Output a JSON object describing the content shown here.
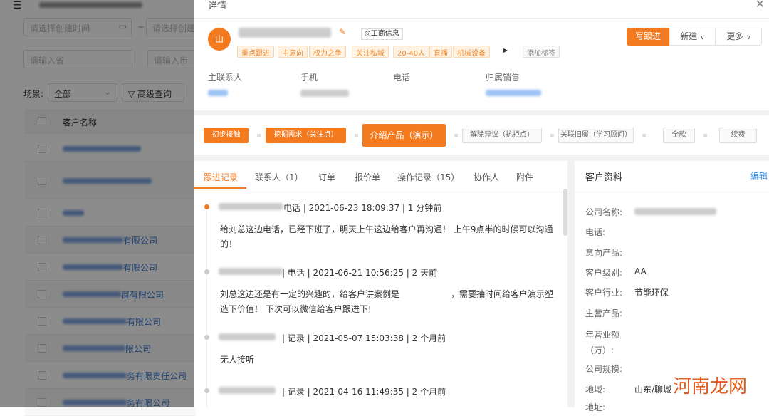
{
  "background": {
    "filters": {
      "date_placeholder": "请选择创建时间",
      "date_placeholder2": "请选择创建",
      "range_sep": "~",
      "province_placeholder": "请输入省",
      "city_placeholder": "请输入市"
    },
    "scene_label": "场景:",
    "scene_value": "全部",
    "advanced_query": "高级查询",
    "table_header": "客户名称",
    "rows": [
      "",
      "",
      "",
      "有限公司",
      "有限公司",
      "窗有限公司",
      "有限公司",
      "限公司",
      "务有限责任公司",
      "务有限公司"
    ]
  },
  "panel": {
    "title": "详情",
    "avatar_text": "山",
    "business_info": "工商信息",
    "tags": [
      "重点跟进",
      "中意向",
      "权力之争",
      "关注私域",
      "20-40人",
      "直播",
      "机械设备"
    ],
    "add_tag": "添加标签",
    "actions": {
      "write_followup": "写跟进",
      "new": "新建",
      "more": "更多"
    },
    "contact_labels": [
      "主联系人",
      "手机",
      "电话",
      "归属销售"
    ],
    "stages": [
      {
        "label": "初步接触",
        "active": true
      },
      {
        "label": "挖掘需求（关注点）",
        "active": true
      },
      {
        "label": "介绍产品（演示）",
        "active": true,
        "current": true
      },
      {
        "label": "解除异议（抗拒点）",
        "active": false
      },
      {
        "label": "关联旧履（学习顾问）",
        "active": false
      },
      {
        "label": "全款",
        "active": false
      },
      {
        "label": "续费",
        "active": false
      }
    ],
    "tabs": [
      "跟进记录",
      "联系人（1）",
      "订单",
      "报价单",
      "操作记录（15）",
      "协作人",
      "附件"
    ],
    "active_tab": "跟进记录",
    "records": [
      {
        "meta": "电话 | 2021-06-23 18:09:37 | 1 分钟前",
        "body": "给刘总这边电话，已经下班了，明天上午这边给客户再沟通！ 上午9点半的时候可以沟通的！"
      },
      {
        "meta": "| 电话 | 2021-06-21 10:56:25 | 2 天前",
        "body": "刘总这边还是有一定的兴趣的，给客户讲案例是　　　　　　，需要抽时间给客户演示塑造下价值！ 下次可以微信给客户跟进下!"
      },
      {
        "meta": "| 记录 | 2021-05-07 15:03:38 | 2 个月前",
        "body": "无人接听"
      },
      {
        "meta": "| 记录 | 2021-04-16 11:49:35 | 2 个月前",
        "body": ""
      }
    ],
    "profile": {
      "title": "客户资料",
      "edit": "编辑",
      "fields": [
        {
          "label": "公司名称:",
          "value": ""
        },
        {
          "label": "电话:",
          "value": ""
        },
        {
          "label": "意向产品:",
          "value": ""
        },
        {
          "label": "客户级别:",
          "value": "AA"
        },
        {
          "label": "客户行业:",
          "value": "节能环保"
        },
        {
          "label": "主营产品:",
          "value": ""
        },
        {
          "label": "年营业额（万）:",
          "value": ""
        },
        {
          "label": "公司规模:",
          "value": ""
        },
        {
          "label": "地域:",
          "value": "山东/聊城"
        },
        {
          "label": "地址:",
          "value": ""
        }
      ]
    }
  },
  "watermark": "河南龙网",
  "colors": {
    "accent": "#f47a20",
    "link": "#3a8ee6",
    "tag_bg": "#fdf2e4"
  }
}
